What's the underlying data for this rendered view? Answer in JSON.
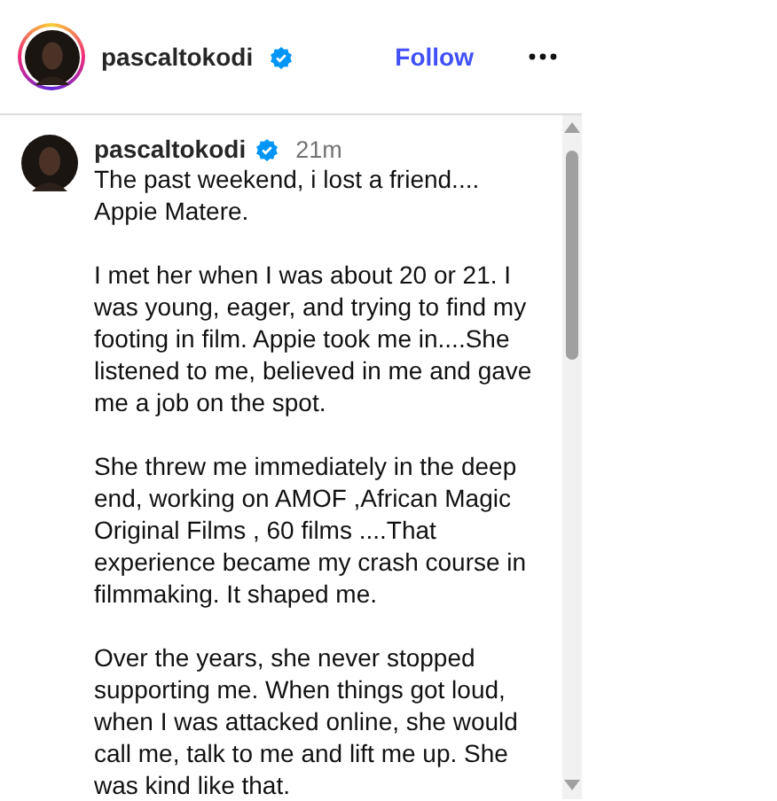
{
  "header": {
    "username": "pascaltokodi",
    "verified": true,
    "follow_label": "Follow"
  },
  "caption": {
    "username": "pascaltokodi",
    "verified": true,
    "time": "21m",
    "paragraphs": [
      "The past weekend, i lost a friend.... Appie Matere.",
      "I met her when I was about 20 or 21. I was young, eager, and trying to find my footing in film. Appie took me in....She listened to me, believed in me and gave me a job on the spot.",
      "She threw me immediately in the deep end,  working on AMOF ,African Magic Original Films , 60 films ....That experience became my crash course in filmmaking. It shaped me.",
      "Over the years, she never stopped supporting me. When things got loud, when I was attacked online, she would call me, talk to me and lift me up. She was kind like that."
    ]
  }
}
